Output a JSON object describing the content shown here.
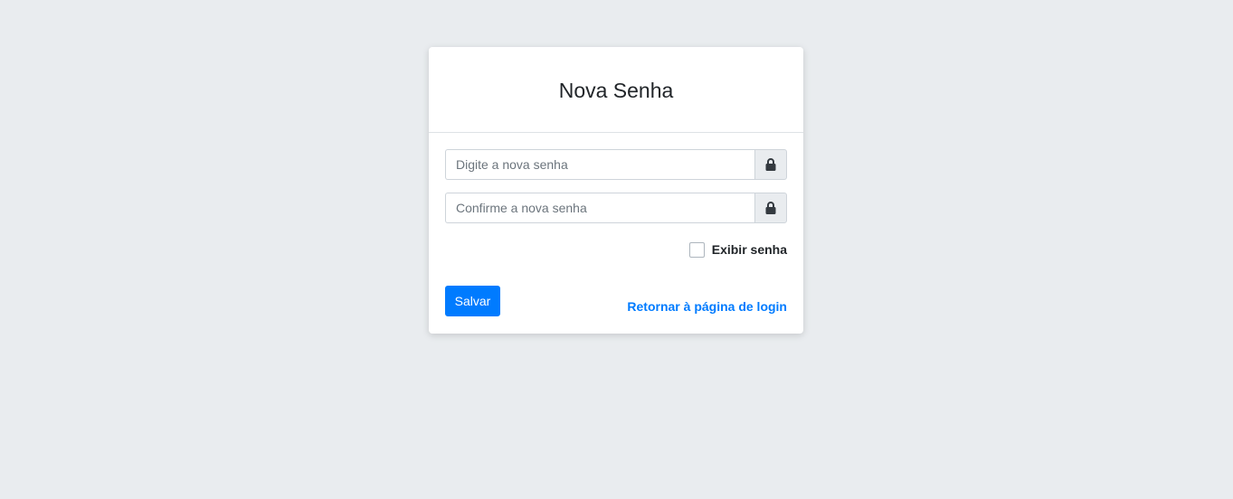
{
  "card": {
    "title": "Nova Senha"
  },
  "form": {
    "new_password": {
      "placeholder": "Digite a nova senha",
      "value": "",
      "icon": "lock-icon"
    },
    "confirm_password": {
      "placeholder": "Confirme a nova senha",
      "value": "",
      "icon": "lock-icon"
    },
    "show_password": {
      "label": "Exibir senha",
      "checked": false
    },
    "save_label": "Salvar",
    "login_link_label": "Retornar à página de login"
  },
  "colors": {
    "background": "#e9ecef",
    "primary": "#007bff",
    "addon": "#e9ecef",
    "icon": "#343a40"
  }
}
